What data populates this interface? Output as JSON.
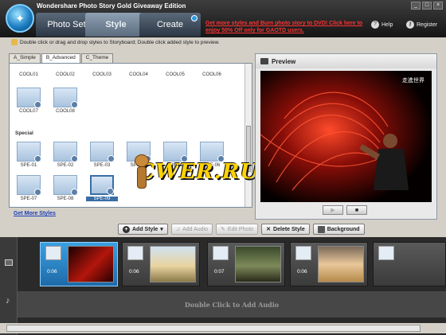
{
  "app": {
    "title": "Wondershare Photo Story Gold Giveaway Edition",
    "window_buttons": [
      "_",
      "□",
      "×"
    ]
  },
  "nav": {
    "tabs": [
      {
        "label": "Photo Set",
        "active": false
      },
      {
        "label": "Style",
        "active": true
      },
      {
        "label": "Create",
        "active": false
      }
    ],
    "promo_line1": "Get more styles and Burn photo story to DVD! Click here to",
    "promo_line2": "enjoy 50% Off only for GAOTD users.",
    "help_label": "Help",
    "register_label": "Register"
  },
  "hint": "Double click or drag and drop styles to Storyboard; Double click added style to preview.",
  "styles": {
    "tabs": [
      "A_Simple",
      "B_Advanced",
      "C_Theme"
    ],
    "active_tab": "B_Advanced",
    "cool_row1": [
      "COOL01",
      "COOL02",
      "COOL03",
      "COOL04",
      "COOL05",
      "COOL06"
    ],
    "cool_row2": [
      "COOL07",
      "COOL08"
    ],
    "special_heading": "Special",
    "spe_row1": [
      "SPE-01",
      "SPE-02",
      "SPE-03",
      "SPE-04",
      "SPE-05",
      "SPE-06"
    ],
    "spe_row2": [
      "SPE-07",
      "SPE-08",
      "SPE-09"
    ],
    "selected": "SPE-09",
    "get_more": "Get More Styles"
  },
  "watermark_text": "CWER.RU",
  "preview": {
    "title": "Preview",
    "image_text": "走進世界"
  },
  "toolbar": {
    "add_style": "Add Style",
    "add_audio": "Add Audio",
    "edit_photo": "Edit Photo",
    "delete_style": "Delete Style",
    "background": "Background"
  },
  "storyboard": {
    "frames": [
      {
        "duration": "0:06",
        "selected": true
      },
      {
        "duration": "0:06",
        "selected": false
      },
      {
        "duration": "0:07",
        "selected": false
      },
      {
        "duration": "0:06",
        "selected": false
      },
      {
        "duration": "",
        "selected": false
      }
    ],
    "audio_hint": "Double Click to Add Audio"
  },
  "colors": {
    "accent": "#3a6ea5",
    "promo": "#ff3333",
    "link": "#1d3fb8",
    "selected_frame": "#2a88cc"
  }
}
